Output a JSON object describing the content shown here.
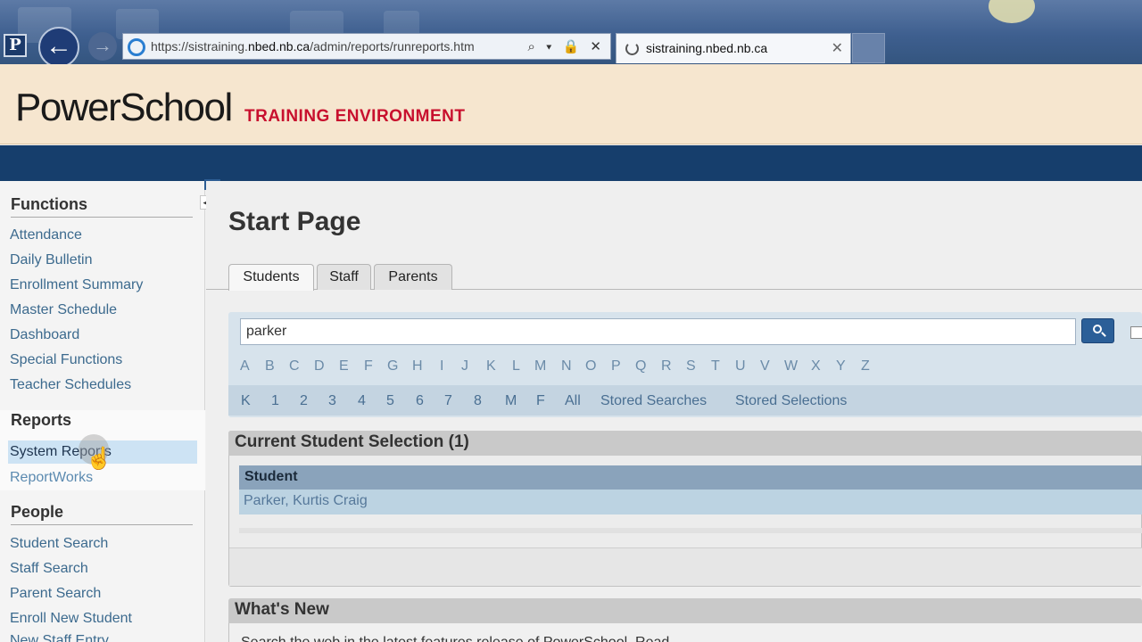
{
  "browser": {
    "url": "https://sistraining.nbed.nb.ca/admin/reports/runreports.htm",
    "url_prefix": "https://sistraining.",
    "url_domain": "nbed.nb.ca",
    "url_path": "/admin/reports/runreports.htm",
    "tab_title": "sistraining.nbed.nb.ca",
    "address_icons": "⌕ ▾ 🔒 ✕",
    "tab_close": "✕",
    "back_glyph": "←",
    "forward_glyph": "→",
    "favicon_letter": "P"
  },
  "header": {
    "logo": "PowerSchool",
    "environment": "TRAINING ENVIRONMENT"
  },
  "sidebar": {
    "functions": {
      "heading": "Functions",
      "items": [
        "Attendance",
        "Daily Bulletin",
        "Enrollment Summary",
        "Master Schedule",
        "Dashboard",
        "Special Functions",
        "Teacher Schedules"
      ]
    },
    "reports": {
      "heading": "Reports",
      "items": [
        "System Reports",
        "ReportWorks"
      ]
    },
    "people": {
      "heading": "People",
      "items": [
        "Student Search",
        "Staff Search",
        "Parent Search",
        "Enroll New Student",
        "New Staff Entry"
      ]
    }
  },
  "main": {
    "title": "Start Page",
    "tabs": [
      "Students",
      "Staff",
      "Parents"
    ],
    "search": {
      "value": "parker"
    },
    "letters": [
      "A",
      "B",
      "C",
      "D",
      "E",
      "F",
      "G",
      "H",
      "I",
      "J",
      "K",
      "L",
      "M",
      "N",
      "O",
      "P",
      "Q",
      "R",
      "S",
      "T",
      "U",
      "V",
      "W",
      "X",
      "Y",
      "Z"
    ],
    "grades": [
      "K",
      "1",
      "2",
      "3",
      "4",
      "5",
      "6",
      "7",
      "8",
      "M",
      "F",
      "All"
    ],
    "stored_searches": "Stored Searches",
    "stored_selections": "Stored Selections",
    "selection": {
      "title": "Current Student Selection (1)",
      "column": "Student",
      "students": [
        "Parker, Kurtis Craig"
      ]
    },
    "whats_new": {
      "title": "What's New",
      "text": "Search the web in the latest features release of PowerSchool, Read..."
    }
  },
  "colors": {
    "accent_red": "#c8102e",
    "brand_navy": "#163e6c",
    "header_bg": "#f6e6cf",
    "link_blue": "#3c6a8e"
  }
}
